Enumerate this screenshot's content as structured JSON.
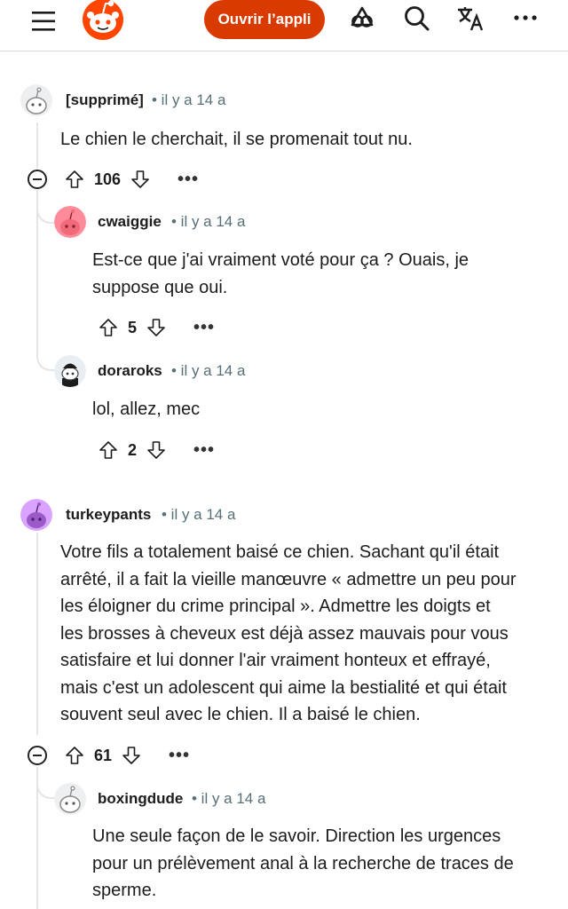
{
  "header": {
    "open_app_label": "Ouvrir l’appli",
    "icons": [
      "hamburger-menu-icon",
      "reddit-logo",
      "advertise-icon",
      "search-icon",
      "translate-icon",
      "more-options-icon"
    ]
  },
  "colors": {
    "accent": "#d93a00",
    "muted": "#576f76",
    "thread": "#e2e6e8"
  },
  "comments": [
    {
      "author": "[supprimé]",
      "meta": "• il y a 14 a",
      "body": "Le chien le cherchait, il se promenait tout nu.",
      "votes": "106"
    },
    {
      "author": "cwaiggie",
      "meta": "• il y a 14 a",
      "body_lines": [
        "Est-ce que j'ai vraiment voté pour ça ? Ouais, je",
        "suppose que oui."
      ],
      "votes": "5"
    },
    {
      "author": "doraroks",
      "meta": "• il y a 14 a",
      "body": "lol, allez, mec",
      "votes": "2"
    },
    {
      "author": "turkeypants",
      "meta": "• il y a 14 a",
      "body_lines": [
        "Votre fils a totalement baisé ce chien. Sachant qu'il était",
        "arrêté, il a fait la vieille manœuvre « admettre un peu pour",
        "les éloigner du crime principal ». Admettre les doigts et",
        "les brosses à cheveux est déjà assez mauvais pour vous",
        "satisfaire et lui donner l'air vraiment honteux et effrayé,",
        "mais c'est un adolescent qui aime la bestialité et qui était",
        "souvent seul avec le chien. Il a baisé le chien."
      ],
      "votes": "61"
    },
    {
      "author": "boxingdude",
      "meta": "• il y a 14 a",
      "body_lines": [
        "Une seule façon de le savoir. Direction les urgences",
        "pour un prélèvement anal à la recherche de traces de",
        "sperme."
      ]
    }
  ],
  "more_label": "•••"
}
